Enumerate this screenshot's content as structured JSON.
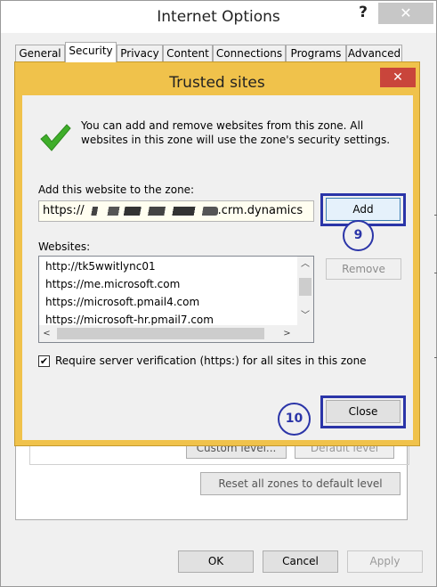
{
  "outer_window": {
    "title": "Internet Options",
    "help_label": "?",
    "close_label": "✕",
    "tabs": [
      {
        "label": "General"
      },
      {
        "label": "Security"
      },
      {
        "label": "Privacy"
      },
      {
        "label": "Content"
      },
      {
        "label": "Connections"
      },
      {
        "label": "Programs"
      },
      {
        "label": "Advanced"
      }
    ],
    "active_tab": "Security",
    "custom_level_label": "Custom level...",
    "default_level_label": "Default level",
    "reset_all_label": "Reset all zones to default level",
    "ok_label": "OK",
    "cancel_label": "Cancel",
    "apply_label": "Apply"
  },
  "dialog": {
    "title": "Trusted sites",
    "close_label": "✕",
    "info_text": "You can add and remove websites from this zone. All websites in this zone will use the zone's security settings.",
    "add_label": "Add this website to the zone:",
    "url_prefix": "https://",
    "url_suffix": ".crm.dynamics",
    "add_button": "Add",
    "websites_label": "Websites:",
    "websites": [
      "http://tk5wwitlync01",
      "https://me.microsoft.com",
      "https://microsoft.pmail4.com",
      "https://microsoft-hr.pmail7.com"
    ],
    "remove_button": "Remove",
    "require_label": "Require server verification (https:) for all sites in this zone",
    "require_checked": true,
    "close_button": "Close"
  },
  "annotations": {
    "step_add": "9",
    "step_close": "10",
    "highlight_color": "#2b35a8"
  },
  "colors": {
    "dialog_frame": "#f0c24b",
    "dialog_close": "#c9453b",
    "check_green": "#3fae2a"
  }
}
